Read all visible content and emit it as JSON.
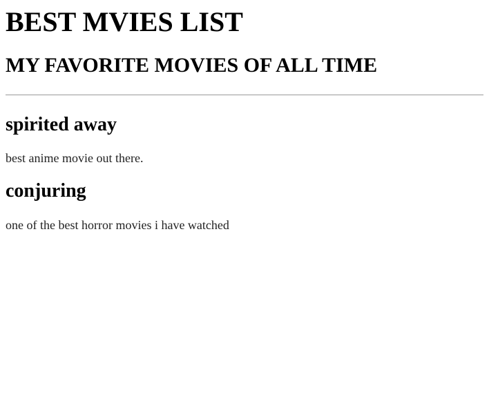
{
  "page": {
    "title": "BEST MVIES LIST",
    "subtitle": "MY FAVORITE MOVIES OF ALL TIME"
  },
  "movies": [
    {
      "title": "spirited away",
      "description": "best anime movie out there."
    },
    {
      "title": "conjuring",
      "description": "one of the best horror movies i have watched"
    }
  ]
}
